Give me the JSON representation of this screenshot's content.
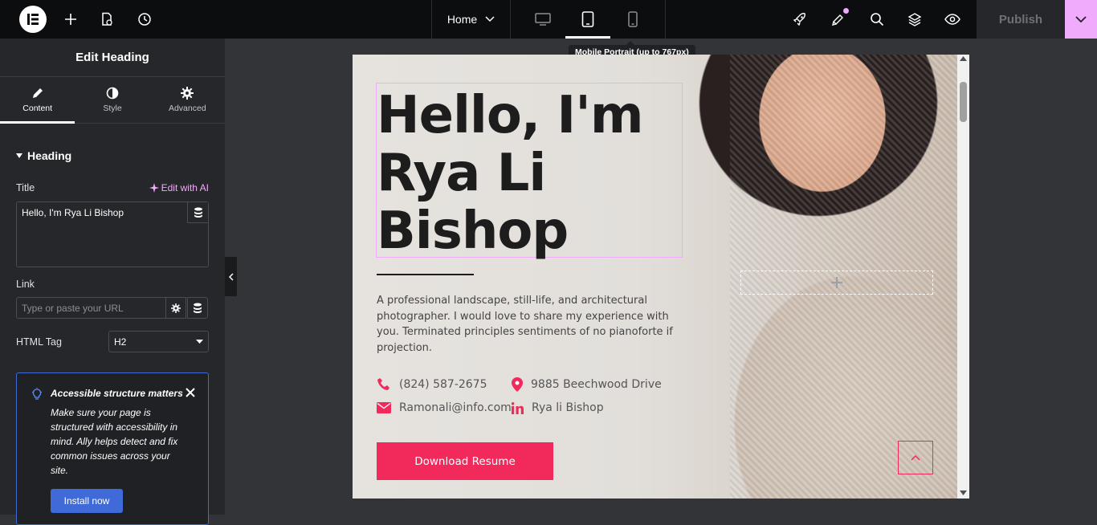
{
  "topbar": {
    "page_name": "Home",
    "tooltip": "Mobile Portrait (up to 767px)",
    "publish_label": "Publish"
  },
  "panel": {
    "title": "Edit Heading",
    "tabs": [
      {
        "label": "Content"
      },
      {
        "label": "Style"
      },
      {
        "label": "Advanced"
      }
    ],
    "section": "Heading",
    "title_label": "Title",
    "ai_label": "Edit with AI",
    "title_value": "Hello, I'm Rya Li Bishop",
    "link_label": "Link",
    "link_placeholder": "Type or paste your URL",
    "html_tag_label": "HTML Tag",
    "html_tag_value": "H2",
    "notice": {
      "title": "Accessible structure matters",
      "body": "Make sure your page is structured with accessibility in mind. Ally helps detect and fix common issues across your site.",
      "button": "Install now"
    }
  },
  "canvas": {
    "heading": "Hello, I'm Rya Li Bishop",
    "description": "A professional landscape, still-life, and architectural photographer. I would love to share my experience with you. Terminated principles sentiments of no pianoforte if projection.",
    "phone": "(824) 587-2675",
    "address": "9885 Beechwood Drive",
    "email": "Ramonali@info.com",
    "linkedin": "Rya li Bishop",
    "cta": "Download Resume"
  },
  "colors": {
    "accent": "#f2295b",
    "editor_pink": "#f0abfc",
    "notice_blue": "#3f6ad8"
  }
}
